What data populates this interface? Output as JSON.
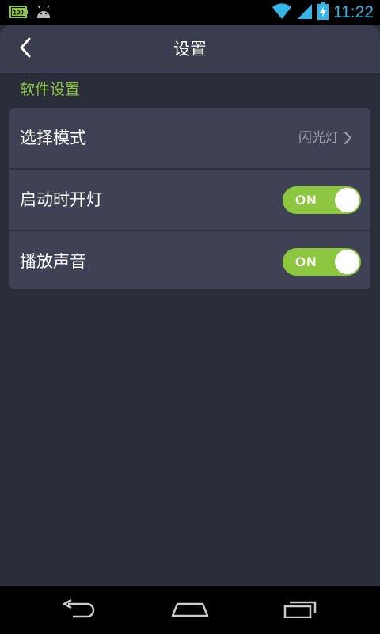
{
  "status_bar": {
    "time": "11:22",
    "battery_badge": "100",
    "icons": [
      "battery-full-icon",
      "android-icon",
      "wifi-icon",
      "signal-icon",
      "battery-charging-icon"
    ],
    "time_color": "#33b5e5"
  },
  "header": {
    "title": "设置",
    "back_icon": "chevron-left-icon"
  },
  "section": {
    "title": "软件设置",
    "accent_color": "#8dc63f"
  },
  "settings": {
    "mode": {
      "label": "选择模式",
      "value": "闪光灯"
    },
    "light_on_start": {
      "label": "启动时开灯",
      "toggle_text": "ON",
      "enabled": true
    },
    "play_sound": {
      "label": "播放声音",
      "toggle_text": "ON",
      "enabled": true
    }
  },
  "nav_bar": {
    "icons": [
      "back-icon",
      "home-icon",
      "recent-apps-icon"
    ]
  }
}
